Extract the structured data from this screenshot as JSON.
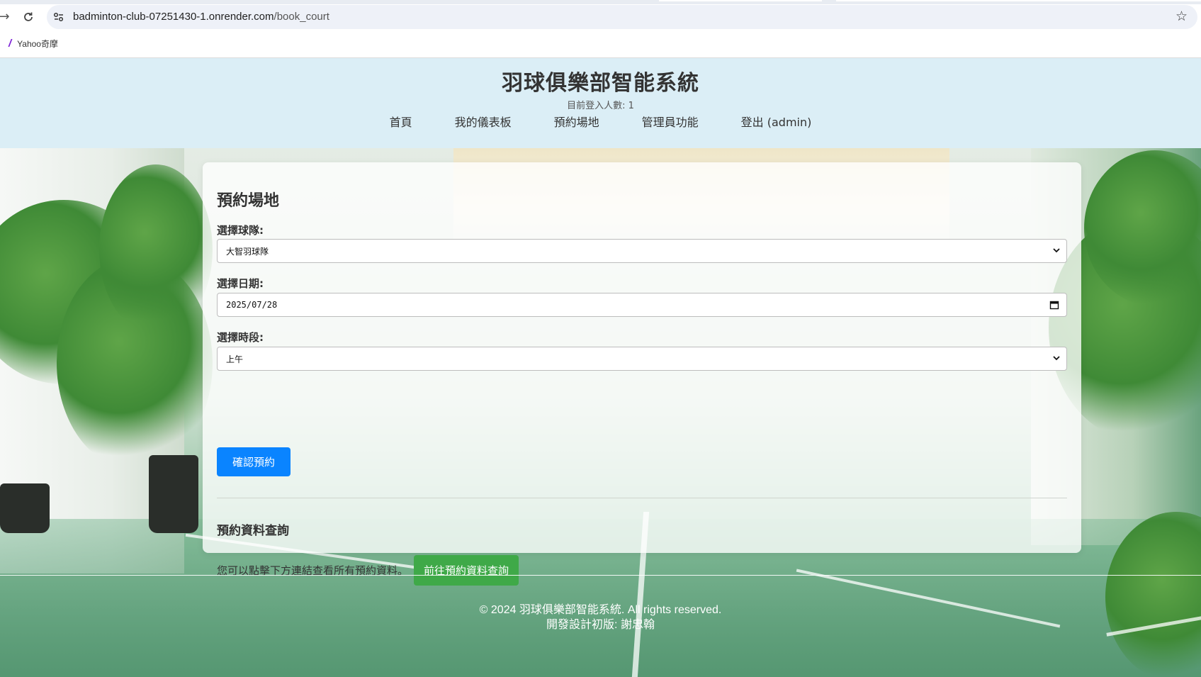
{
  "browser": {
    "url_host": "badminton-club-07251430-1.onrender.com",
    "url_path": "/book_court",
    "bookmark_label": "Yahoo奇摩"
  },
  "header": {
    "title": "羽球俱樂部智能系統",
    "login_count": "目前登入人數: 1",
    "nav": [
      "首頁",
      "我的儀表板",
      "預約場地",
      "管理員功能",
      "登出 (admin)"
    ]
  },
  "booking": {
    "heading": "預約場地",
    "team_label": "選擇球隊:",
    "team_value": "大智羽球隊",
    "date_label": "選擇日期:",
    "date_value": "2025/07/28",
    "slot_label": "選擇時段:",
    "slot_value": "上午",
    "confirm_label": "確認預約"
  },
  "query": {
    "heading": "預約資料查詢",
    "text": "您可以點擊下方連結查看所有預約資料。",
    "button_label": "前往預約資料查詢"
  },
  "footer": {
    "line1": "© 2024 羽球俱樂部智能系統. All rights reserved.",
    "line2": "開發設計初版: 謝忠翰"
  },
  "colors": {
    "header_bg": "#dbeef6",
    "primary": "#0a84ff",
    "success": "#3fa948"
  }
}
